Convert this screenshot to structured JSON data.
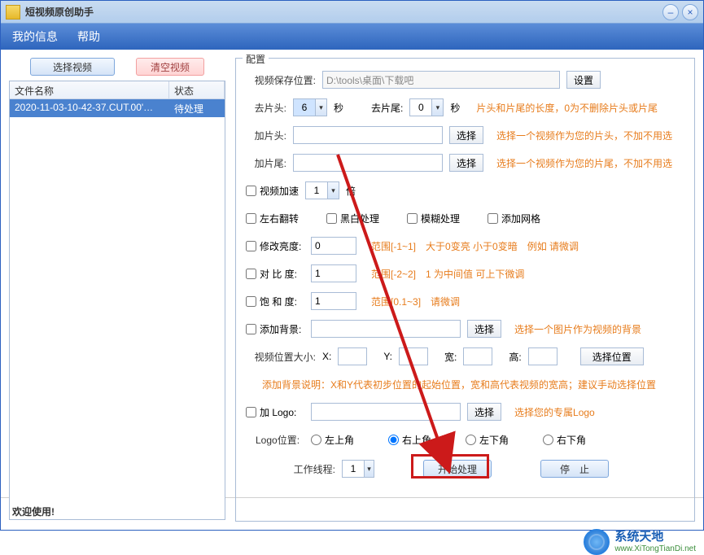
{
  "window": {
    "title": "短视频原创助手"
  },
  "menu": {
    "myinfo": "我的信息",
    "help": "帮助"
  },
  "leftbtns": {
    "select": "选择视频",
    "clear": "清空视频"
  },
  "table": {
    "col_name": "文件名称",
    "col_status": "状态",
    "row1_name": "2020-11-03-10-42-37.CUT.00'…",
    "row1_status": "待处理"
  },
  "config": {
    "legend": "配置",
    "save_label": "视频保存位置:",
    "save_value": "D:\\tools\\桌面\\下载吧",
    "set_btn": "设置",
    "trim_head": "去片头:",
    "trim_head_val": "6",
    "sec": "秒",
    "trim_tail": "去片尾:",
    "trim_tail_val": "0",
    "trim_hint": "片头和片尾的长度，0为不删除片头或片尾",
    "add_head": "加片头:",
    "select": "选择",
    "add_head_hint": "选择一个视频作为您的片头，不加不用选",
    "add_tail": "加片尾:",
    "add_tail_hint": "选择一个视频作为您的片尾，不加不用选",
    "speed": "视频加速",
    "speed_val": "1",
    "times": "倍",
    "flip": "左右翻转",
    "bw": "黑白处理",
    "blur": "模糊处理",
    "grid": "添加网格",
    "brightness": "修改亮度:",
    "brightness_val": "0",
    "brightness_hint": "范围[-1~1]　大于0变亮 小于0变暗　例如 请微调",
    "contrast": "对 比  度:",
    "contrast_val": "1",
    "contrast_hint": "范围[-2~2]　1 为中间值  可上下微调",
    "saturate": "饱 和  度:",
    "saturate_val": "1",
    "saturate_hint": "范围[0.1~3]　请微调",
    "addbg": "添加背景:",
    "addbg_hint": "选择一个图片作为视频的背景",
    "pos_label": "视频位置大小:",
    "x": "X:",
    "y": "Y:",
    "w": "宽:",
    "h": "高:",
    "pos_btn": "选择位置",
    "bg_note": "添加背景说明：X和Y代表初步位置的起始位置，宽和高代表视频的宽高；建议手动选择位置",
    "addlogo": "加 Logo:",
    "logo_hint": "选择您的专属Logo",
    "logo_pos_label": "Logo位置:",
    "tl": "左上角",
    "tr": "右上角",
    "bl": "左下角",
    "br": "右下角",
    "threads": "工作线程:",
    "threads_val": "1",
    "start": "开始处理",
    "stop": "停　止"
  },
  "statusbar": "欢迎使用!",
  "watermark": {
    "cn": "系统天地",
    "en": "www.XiTongTianDi.net"
  }
}
